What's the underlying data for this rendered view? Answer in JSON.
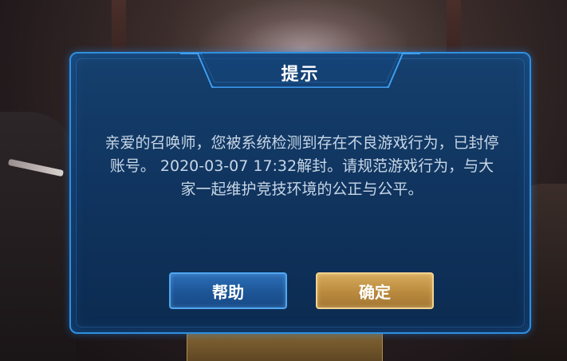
{
  "dialog": {
    "title": "提示",
    "message": "亲爱的召唤师，您被系统检测到存在不良游戏行为，已封停账号。 2020-03-07 17:32解封。请规范游戏行为，与大家一起维护竞技环境的公正与公平。",
    "help_button_label": "帮助",
    "confirm_button_label": "确定"
  },
  "colors": {
    "dialog_border": "#2f8fe0",
    "dialog_background": "#103560",
    "help_button": "#1d5596",
    "confirm_button": "#b98a3e",
    "message_text": "#c8d6e6"
  }
}
